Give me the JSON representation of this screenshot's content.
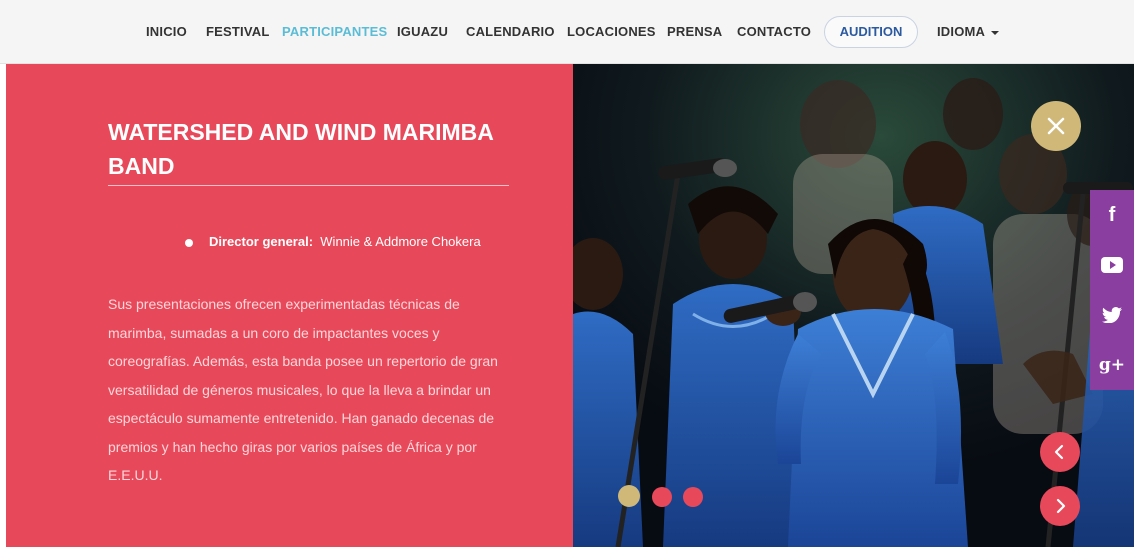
{
  "nav": {
    "items": [
      {
        "label": "INICIO"
      },
      {
        "label": "FESTIVAL"
      },
      {
        "label": "PARTICIPANTES",
        "active": true
      },
      {
        "label": "IGUAZU"
      },
      {
        "label": "CALENDARIO"
      },
      {
        "label": "LOCACIONES"
      },
      {
        "label": "PRENSA"
      },
      {
        "label": "CONTACTO"
      }
    ],
    "audition_label": "AUDITION",
    "language_label": "IDIOMA"
  },
  "participant": {
    "title": "WATERSHED AND WIND MARIMBA BAND",
    "director_label": "Director general:",
    "director_value": "Winnie & Addmore Chokera",
    "description": "Sus presentaciones ofrecen experimentadas técnicas de marimba, sumadas a un coro de impactantes voces y coreografías. Además, esta banda posee un repertorio de gran versatilidad de géneros musicales, lo que la lleva a brindar un espectáculo sumamente entretenido. Han ganado decenas de premios y han hecho giras por varios países de África y por E.E.U.U."
  },
  "social": [
    {
      "icon": "facebook-icon",
      "glyph": "f"
    },
    {
      "icon": "youtube-icon",
      "glyph": "▶"
    },
    {
      "icon": "twitter-icon",
      "glyph": "t"
    },
    {
      "icon": "google-plus-icon",
      "glyph": "g+"
    }
  ],
  "carousel": {
    "slide_count": 3,
    "active_index": 0
  },
  "colors": {
    "panel": "#e8495a",
    "nav_active": "#5bbcd6",
    "audition_text": "#2c5aa0",
    "close_button": "#cfb878",
    "social_bar": "#8a3fa0",
    "dot_active": "#cfb878",
    "dot_inactive": "#e8495a"
  }
}
